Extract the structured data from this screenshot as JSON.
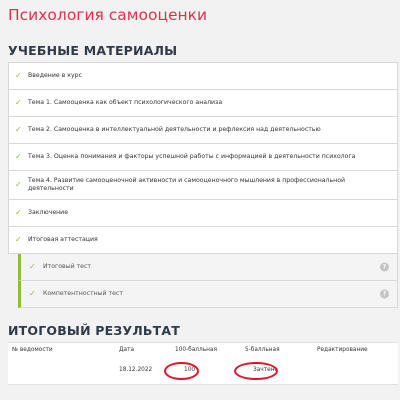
{
  "page": {
    "title": "Психология самооценки"
  },
  "materials": {
    "title": "УЧЕБНЫЕ МАТЕРИАЛЫ",
    "items": [
      {
        "label": "Введение в курс"
      },
      {
        "label": "Тема 1. Самооценка как объект психологического анализа"
      },
      {
        "label": "Тема 2. Самооценка в интеллектуальной деятельности и рефлексия над деятельностью"
      },
      {
        "label": "Тема 3. Оценка понимания и факторы успешной работы с информацией в деятельности психолога"
      },
      {
        "label": "Тема 4. Развитие самооценочной активности и самооценочного мышления в профессиональной деятельности"
      },
      {
        "label": "Заключение"
      },
      {
        "label": "Итоговая аттестация"
      }
    ],
    "sub_items": [
      {
        "label": "Итоговый тест",
        "help": "?"
      },
      {
        "label": "Компетентностный тест",
        "help": "?"
      }
    ],
    "check_glyph": "✓",
    "accent_color": "#8bbf2f"
  },
  "result": {
    "title": "ИТОГОВЫЙ РЕЗУЛЬТАТ",
    "columns": [
      "№ ведомости",
      "Дата",
      "100-балльная",
      "5-балльная",
      "Редактирование"
    ],
    "rows": [
      {
        "number": "",
        "date": "18.12.2022",
        "score100": "100",
        "score5": "Зачтено",
        "edit": ""
      }
    ],
    "highlight_color": "#e0142c"
  }
}
